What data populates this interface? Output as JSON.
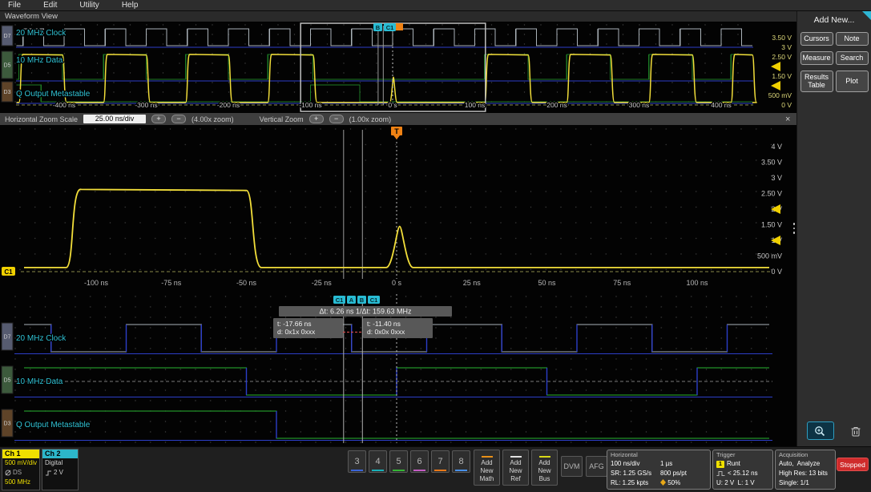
{
  "menu": {
    "items": [
      "File",
      "Edit",
      "Utility",
      "Help"
    ]
  },
  "titlebar": {
    "label": "Waveform View"
  },
  "icons": {
    "plus": "+",
    "minus": "−",
    "close": "×"
  },
  "overview": {
    "channels": [
      {
        "tab": "D7",
        "label": "20 MHz Clock"
      },
      {
        "tab": "D5",
        "label": "10 MHz Data"
      },
      {
        "tab": "D3",
        "label": "Q Output Metastable"
      }
    ],
    "time_labels": [
      "-400 ns",
      "-300 ns",
      "-200 ns",
      "-100 ns",
      "0 s",
      "100 ns",
      "200 ns",
      "300 ns",
      "400 ns"
    ],
    "volt_labels": [
      "3.50 V",
      "3 V",
      "2.50 V",
      "1.50 V",
      "500 mV",
      "0 V"
    ],
    "cursor_badges": [
      "B",
      "C1"
    ]
  },
  "zoom_bar": {
    "label": "Horizontal Zoom Scale",
    "scale": "25.00 ns/div",
    "h_zoom": "(4.00x zoom)",
    "v_label": "Vertical Zoom",
    "v_zoom": "(1.00x zoom)"
  },
  "zoom_view": {
    "time_labels": [
      "-100 ns",
      "-75 ns",
      "-50 ns",
      "-25 ns",
      "0 s",
      "25 ns",
      "50 ns",
      "75 ns",
      "100 ns"
    ],
    "volt_labels": [
      "4 V",
      "3.50 V",
      "3 V",
      "2.50 V",
      "2 V",
      "1.50 V",
      "1 V",
      "500 mV",
      "0 V"
    ],
    "trigger_badge": "T",
    "channel_badge": "C1"
  },
  "digital_view": {
    "channels": [
      {
        "tab": "D7",
        "label": "20 MHz Clock"
      },
      {
        "tab": "D5",
        "label": "10 MHz Data"
      },
      {
        "tab": "D3",
        "label": "Q Output Metastable"
      }
    ],
    "cursor_badges": [
      "C1",
      "A",
      "B",
      "C1"
    ],
    "readout": {
      "delta": "Δt: 6.26 ns 1/Δt: 159.63 MHz",
      "a_time": "t: -17.66 ns",
      "a_data": "d: 0x1x 0xxx",
      "b_time": "t: -11.40 ns",
      "b_data": "d: 0x0x 0xxx"
    }
  },
  "right_panel": {
    "title": "Add New...",
    "buttons": [
      "Cursors",
      "Note",
      "Measure",
      "Search",
      "Results Table",
      "Plot"
    ]
  },
  "badges": {
    "ch1": {
      "name": "Ch 1",
      "scale": "500 mV/div",
      "mid": "DS",
      "bw": "500 MHz"
    },
    "ch2": {
      "name": "Ch 2",
      "mode": "Digital",
      "threshold": "2 V"
    }
  },
  "bottom": {
    "channel_buttons": [
      "3",
      "4",
      "5",
      "6",
      "7",
      "8"
    ],
    "add_buttons": [
      "Add New Math",
      "Add New Ref",
      "Add New Bus"
    ],
    "dvm": "DVM",
    "afg": "AFG",
    "horizontal": {
      "title": "Horizontal",
      "scale": "100 ns/div",
      "window": "1 µs",
      "sr": "SR: 1.25 GS/s",
      "res": "800 ps/pt",
      "rl": "RL: 1.25 kpts",
      "pos": "50%"
    },
    "trigger": {
      "title": "Trigger",
      "source": "1",
      "type": "Runt",
      "condition": "< 25.12 ns",
      "levels": "U: 2 V  L: 1 V"
    },
    "acquisition": {
      "title": "Acquisition",
      "mode": "Auto,  Analyze",
      "detail": "High Res: 13 bits",
      "single": "Single: 1/1"
    },
    "stopped": "Stopped"
  },
  "waveforms": {
    "overview": {
      "xm": {
        "c": 490,
        "k": 1.025
      },
      "t0": -458,
      "t1": 438,
      "y0v": 103,
      "per_v": 24,
      "high_v": 2.6,
      "clock": {
        "period": 50,
        "duty": 0.5,
        "start": -450,
        "yh": 8,
        "yl": 29
      },
      "data_highs": [
        [
          -455,
          -402
        ],
        [
          -352,
          -300
        ],
        [
          -252,
          -200
        ],
        [
          -152,
          -97
        ],
        [
          112,
          165
        ],
        [
          212,
          265
        ],
        [
          312,
          365
        ],
        [
          412,
          455
        ]
      ],
      "data_y": {
        "yh": 40,
        "yl": 71
      },
      "q_highs": [
        [
          -465,
          -428
        ],
        [
          -100,
          -40
        ]
      ],
      "q_y": {
        "yh": 78,
        "yl": 99
      },
      "runt": {
        "t": 1,
        "h": 1.45,
        "w": 4.5
      },
      "blue_lines": [
        31,
        73,
        101
      ],
      "zoom_box": [
        -112,
        113
      ],
      "cursors": [
        -17.66,
        -11.4
      ],
      "volt_ys": [
        19,
        31,
        43,
        67,
        91,
        103
      ],
      "arrow_v": [
        2,
        1
      ],
      "time_ticks_t": [
        -400,
        -300,
        -200,
        -100,
        0,
        100,
        200,
        300,
        400
      ]
    },
    "zoom": {
      "xm": {
        "c": 495,
        "k": 3.75
      },
      "t0": -124,
      "t1": 124,
      "y0v": 183,
      "per_v": 39,
      "high_v": 2.6,
      "analog_highs": [
        [
          -110,
          -50
        ]
      ],
      "runt": {
        "t": 1,
        "h": 1.45,
        "w": 4.5
      },
      "volt_ys": [
        27,
        46.5,
        66,
        85.5,
        105,
        124.5,
        144,
        163.5,
        183
      ],
      "time_ticks_t": [
        -100,
        -75,
        -50,
        -25,
        0,
        25,
        50,
        75,
        100
      ],
      "arrow_v": [
        2,
        1
      ],
      "cursors": [
        -17.66,
        -11.4
      ]
    },
    "digital": {
      "xm": {
        "c": 495,
        "k": 3.75
      },
      "t0": -124,
      "t1": 124,
      "clock_highs": [
        [
          -140,
          -115
        ],
        [
          -90,
          -65
        ],
        [
          -40,
          -15
        ],
        [
          10,
          35
        ],
        [
          60,
          85
        ],
        [
          110,
          135
        ]
      ],
      "data_highs": [
        [
          -150,
          -50
        ],
        [
          0,
          50
        ],
        [
          100,
          150
        ]
      ],
      "q_highs": [
        [
          -150,
          -40
        ]
      ],
      "rows": [
        {
          "yh": 38,
          "yl": 72,
          "blue": 74.5
        },
        {
          "yh": 92,
          "yl": 126,
          "blue": 128.5
        },
        {
          "yh": 146,
          "yl": 180,
          "blue": 182.5
        }
      ],
      "cursors": [
        -17.66,
        -11.4
      ],
      "trigger_t": 0
    }
  },
  "colors": {
    "yellow": "#f2de3a",
    "cyan": "#30c2d4",
    "green": "#28b432",
    "green_dim": "#1c7a24",
    "blue": "#2c3ec8",
    "gray_trace": "#aab2b8",
    "orange": "#f08214",
    "red": "#cc4848"
  }
}
